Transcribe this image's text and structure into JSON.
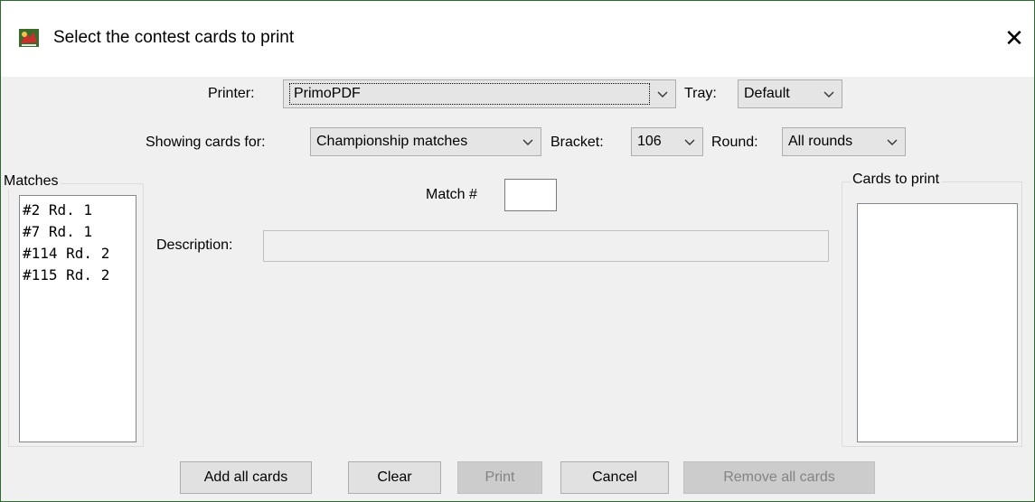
{
  "window": {
    "title": "Select the contest cards to print",
    "icon": "app-logo-icon",
    "close_icon": "close-icon",
    "close_glyph": "✕"
  },
  "printer": {
    "label": "Printer:",
    "value": "PrimoPDF",
    "tray_label": "Tray:",
    "tray_value": "Default"
  },
  "filter": {
    "showing_label": "Showing cards for:",
    "showing_value": "Championship matches",
    "bracket_label": "Bracket:",
    "bracket_value": "106",
    "round_label": "Round:",
    "round_value": "All rounds"
  },
  "matches": {
    "title": "Matches",
    "items": [
      "#2 Rd. 1",
      "#7 Rd. 1",
      "#114 Rd. 2",
      "#115 Rd. 2"
    ]
  },
  "detail": {
    "match_label": "Match #",
    "match_value": "",
    "description_label": "Description:",
    "description_value": ""
  },
  "cards_to_print": {
    "title": "Cards to print",
    "items": []
  },
  "buttons": {
    "add_all": "Add all cards",
    "clear": "Clear",
    "print": "Print",
    "cancel": "Cancel",
    "remove_all": "Remove all cards"
  },
  "colors": {
    "window_border": "#2d6a2d",
    "dialog_bg": "#f0f0f0",
    "disabled_text": "#838383"
  }
}
